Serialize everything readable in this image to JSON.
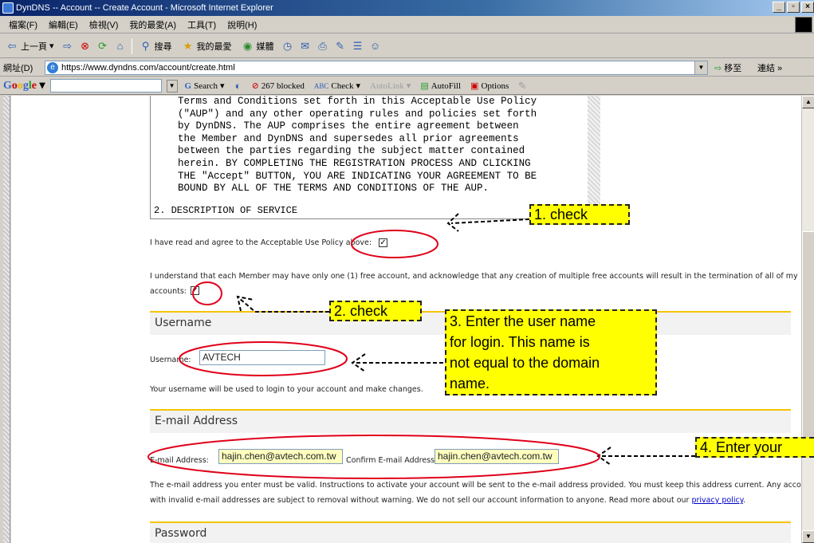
{
  "window": {
    "title": "DynDNS -- Account -- Create Account - Microsoft Internet Explorer"
  },
  "menu": [
    "檔案(F)",
    "編輯(E)",
    "檢視(V)",
    "我的最愛(A)",
    "工具(T)",
    "說明(H)"
  ],
  "nav": {
    "back": "上一頁",
    "search": "搜尋",
    "favorites": "我的最愛",
    "media": "媒體"
  },
  "address": {
    "label": "網址(D)",
    "url": "https://www.dyndns.com/account/create.html",
    "go": "移至",
    "links": "連結"
  },
  "google": {
    "logo": "Google",
    "search": "Search",
    "blocked": "267 blocked",
    "check": "Check",
    "autolink": "AutoLink",
    "autofill": "AutoFill",
    "options": "Options"
  },
  "aup": {
    "lines": [
      "Terms and Conditions set forth in this Acceptable Use Policy",
      "(\"AUP\") and any other operating rules and policies set forth",
      "by DynDNS. The AUP comprises the entire agreement between",
      "the Member and DynDNS and supersedes all prior agreements",
      "between the parties regarding the subject matter contained",
      "herein. BY COMPLETING THE REGISTRATION PROCESS AND CLICKING",
      "THE \"Accept\" BUTTON, YOU ARE INDICATING YOUR AGREEMENT TO BE",
      "BOUND BY ALL OF THE TERMS AND CONDITIONS OF THE AUP."
    ],
    "next_heading": "2. DESCRIPTION OF SERVICE"
  },
  "form": {
    "aup_agree": "I have read and agree to the Acceptable Use Policy above:",
    "one_account_line1": "I understand that each Member may have only one (1) free account, and acknowledge that any creation of multiple free accounts will result in the termination of all of my",
    "one_account_line2": "accounts:",
    "username_section": "Username",
    "username_label": "Username:",
    "username_value": "AVTECH",
    "username_help": "Your username will be used to login to your account and make changes.",
    "email_section": "E-mail Address",
    "email_label": "E-mail Address:",
    "email_value": "hajin.chen@avtech.com.tw",
    "confirm_label": "Confirm E-mail Address:",
    "confirm_value": "hajin.chen@avtech.com.tw",
    "email_help_line1": "The e-mail address you enter must be valid. Instructions to activate your account will be sent to the e-mail address provided. You must keep this address current. Any accounts",
    "email_help_line2": "with invalid e-mail addresses are subject to removal without warning. We do not sell our account information to anyone. Read more about our",
    "privacy_link": "privacy policy",
    "password_section": "Password"
  },
  "annotations": {
    "step1": "1. check",
    "step2": "2. check",
    "step3_lines": [
      "3. Enter the user name",
      "for login. This name is",
      "not equal to the domain",
      "name."
    ],
    "step4": "4. Enter your"
  }
}
